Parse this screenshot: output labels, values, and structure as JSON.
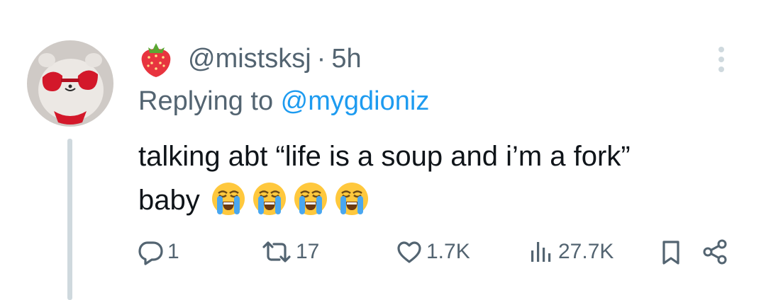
{
  "tweet": {
    "author_handle": "@mistsksj",
    "separator": "·",
    "time_ago": "5h",
    "replying_prefix": "Replying to ",
    "replying_to": "@mygdioniz",
    "text_line1": "talking abt “life is a soup and i’m a fork”",
    "text_line2": "baby",
    "emoji_count": 4,
    "emoji_name": "loudly-crying-face"
  },
  "actions": {
    "replies": "1",
    "retweets": "17",
    "likes": "1.7K",
    "views": "27.7K"
  },
  "colors": {
    "text": "#0f1419",
    "secondary": "#536471",
    "link": "#1d9bf0",
    "thread_line": "#cfd9de"
  },
  "icons": {
    "author_badge": "strawberry-icon",
    "reply": "reply-icon",
    "retweet": "retweet-icon",
    "like": "heart-icon",
    "views": "views-icon",
    "bookmark": "bookmark-icon",
    "share": "share-icon",
    "more": "more-icon"
  }
}
